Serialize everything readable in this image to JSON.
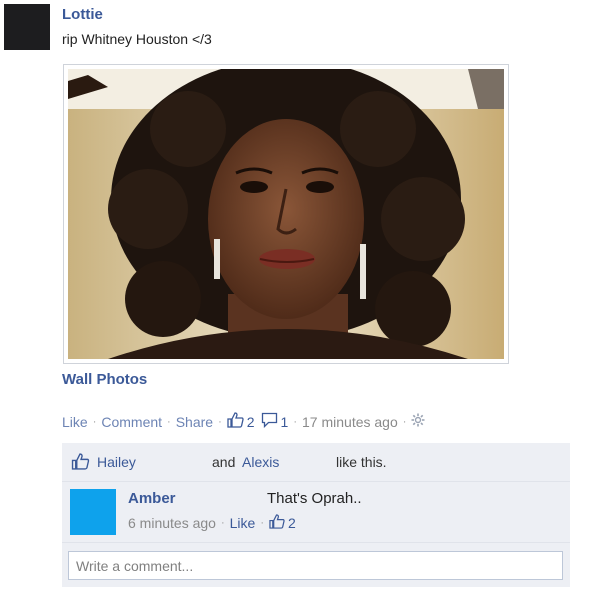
{
  "post": {
    "author": "Lottie",
    "status": "rip Whitney Houston </3",
    "album_link": "Wall Photos"
  },
  "actions": {
    "like": "Like",
    "comment": "Comment",
    "share": "Share",
    "like_count": "2",
    "comment_count": "1",
    "timestamp": "17 minutes ago"
  },
  "likes": {
    "name_1": "Hailey",
    "and": "and",
    "name_2": "Alexis",
    "suffix": "like this."
  },
  "comment": {
    "author": "Amber",
    "text": "That's Oprah..",
    "timestamp": "6 minutes ago",
    "like": "Like",
    "like_count": "2"
  },
  "composer": {
    "placeholder": "Write a comment..."
  },
  "colors": {
    "link": "#3b5998",
    "ufi_background": "#edeff4",
    "comment_avatar": "#0ea2ec"
  }
}
